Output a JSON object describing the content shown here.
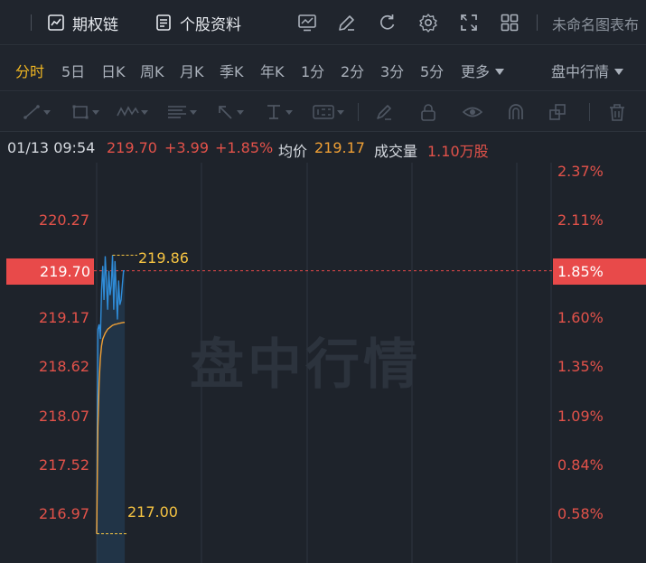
{
  "toolbar": {
    "option_chain_label": "期权链",
    "stock_info_label": "个股资料",
    "chart_name": "未命名图表布"
  },
  "periods": {
    "items": [
      "分时",
      "5日",
      "日K",
      "周K",
      "月K",
      "季K",
      "年K",
      "1分",
      "2分",
      "3分",
      "5分"
    ],
    "more_label": "更多",
    "mode_label": "盘中行情",
    "active_index": 0
  },
  "info": {
    "datetime": "01/13 09:54",
    "price": "219.70",
    "change": "+3.99",
    "change_pct": "+1.85%",
    "avg_label": "均价",
    "avg_value": "219.17",
    "volume_label": "成交量",
    "volume_value": "1.10万股"
  },
  "chart": {
    "watermark": "盘中行情",
    "price_labels": [
      "220.27",
      "219.17",
      "218.62",
      "218.07",
      "217.52",
      "216.97"
    ],
    "pct_labels": [
      "2.37%",
      "2.11%",
      "1.60%",
      "1.35%",
      "1.09%",
      "0.84%",
      "0.58%"
    ],
    "current_price": "219.70",
    "current_pct": "1.85%",
    "high_annotation": "219.86",
    "low_annotation": "217.00"
  },
  "chart_data": {
    "type": "line",
    "ylim": [
      216.7,
      220.81
    ],
    "reference_line": 219.7,
    "series": [
      {
        "values": [
          217.0,
          219.1,
          219.15,
          219.0,
          219.5,
          219.75,
          219.4,
          219.85,
          219.6,
          219.3,
          219.7,
          219.45,
          219.55,
          219.86,
          219.3,
          219.8,
          219.5,
          219.2,
          219.6,
          219.35,
          219.4,
          219.55,
          219.7,
          219.7
        ],
        "color": "#2f8cd8"
      },
      {
        "values": [
          217.0,
          218.1,
          218.55,
          218.8,
          218.93,
          219.0,
          219.03,
          219.06,
          219.08,
          219.1,
          219.11,
          219.12,
          219.13,
          219.14,
          219.145,
          219.15,
          219.152,
          219.155,
          219.16,
          219.162,
          219.165,
          219.167,
          219.17,
          219.17
        ],
        "color": "#f0a035"
      }
    ]
  },
  "colors": {
    "up": "#e3524a",
    "active": "#f1b722",
    "price_line": "#2f8cd8",
    "avg_line": "#f0a035",
    "annotation": "#f5c342",
    "background": "#1e232b"
  }
}
